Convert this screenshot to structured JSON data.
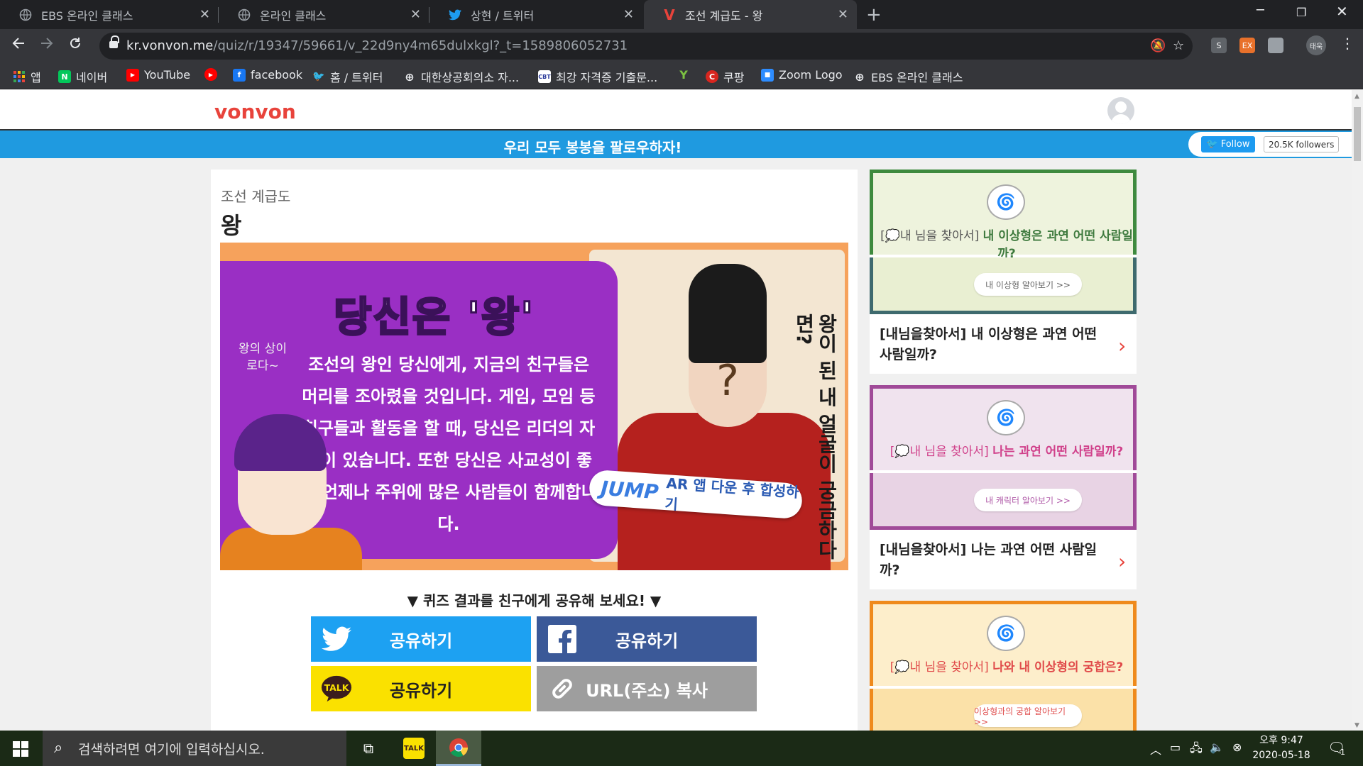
{
  "browser": {
    "tabs": [
      {
        "title": "EBS 온라인 클래스",
        "icon": "globe-icon"
      },
      {
        "title": "온라인 클래스",
        "icon": "globe-icon"
      },
      {
        "title": "상현 / 트위터",
        "icon": "twitter-icon"
      },
      {
        "title": "조선 계급도 - 왕",
        "icon": "vonvon-icon",
        "active": true
      }
    ],
    "address": {
      "host": "kr.vonvon.me",
      "path": "/quiz/r/19347/59661/v_22d9ny4m65dulxkgl?_t=1589806052731"
    },
    "profile_label": "태욱",
    "bookmarks": [
      {
        "label": "앱",
        "icon": "apps-grid-icon"
      },
      {
        "label": "네이버",
        "icon": "naver-icon"
      },
      {
        "label": "YouTube",
        "icon": "youtube-icon"
      },
      {
        "label": "",
        "icon": "youtube-circle-icon"
      },
      {
        "label": "facebook",
        "icon": "facebook-icon"
      },
      {
        "label": "홈 / 트위터",
        "icon": "twitter-icon"
      },
      {
        "label": "대한상공회의소 자...",
        "icon": "globe-icon"
      },
      {
        "label": "최강 자격증 기출문...",
        "icon": "exam-icon"
      },
      {
        "label": "",
        "icon": "y-icon"
      },
      {
        "label": "쿠팡",
        "icon": "coupang-icon"
      },
      {
        "label": "Zoom Logo",
        "icon": "zoom-icon"
      },
      {
        "label": "EBS 온라인 클래스",
        "icon": "globe-icon"
      }
    ],
    "extensions": [
      "S",
      "EX",
      ""
    ]
  },
  "site": {
    "logo": "vonvon",
    "follow_banner": "우리 모두 봉봉을 팔로우하자!",
    "follow_button": "Follow",
    "followers": "20.5K followers"
  },
  "quiz": {
    "series": "조선 계급도",
    "result": "왕",
    "hero": {
      "title": "당신은 '왕'",
      "side_note": "왕의 상이로다~",
      "body": "조선의 왕인 당신에게, 지금의 친구들은 머리를 조아렸을 것입니다. 게임, 모임 등 친구들과 활동을 할 때, 당신은 리더의 자격이 있습니다. 또한 당신은 사교성이 좋아 언제나 주위에 많은 사람들이 함께합니다.",
      "vertical_text": "왕이 된 내 얼굴이 궁금하다면?",
      "ar_brand": "JUMP",
      "ar_text": "AR 앱 다운 후 합성하기"
    },
    "share_title": "▼ 퀴즈 결과를 친구에게 공유해 보세요! ▼",
    "share": {
      "twitter": "공유하기",
      "facebook": "공유하기",
      "kakao": "공유하기",
      "url": "URL(주소) 복사"
    }
  },
  "sidebar": [
    {
      "tag": "[💭내 님을 찾아서]",
      "headline": "내 이상형은 과연 어떤 사람일까?",
      "pill": "내 이상형 알아보기  >>",
      "caption": "[내님을찾아서] 내 이상형은 과연 어떤 사람일까?",
      "color": "#3e8a3e",
      "bg": "#eef3dd"
    },
    {
      "tag": "[💭내 님을 찾아서]",
      "headline": "나는 과연 어떤 사람일까?",
      "pill": "내 캐릭터 알아보기  >>",
      "caption": "[내님을찾아서] 나는 과연 어떤 사람일까?",
      "color": "#a04a98",
      "bg": "#f0e3ee"
    },
    {
      "tag": "[💭내 님을 찾아서]",
      "headline": "나와 내 이상형의 궁합은?",
      "pill": "이상형과의 궁합 알아보기  >>",
      "caption": "",
      "color": "#ef8a1c",
      "bg": "#fdeecb"
    }
  ],
  "taskbar": {
    "search_placeholder": "검색하려면 여기에 입력하십시오.",
    "time": "오후 9:47",
    "date": "2020-05-18",
    "notifications": "1"
  }
}
